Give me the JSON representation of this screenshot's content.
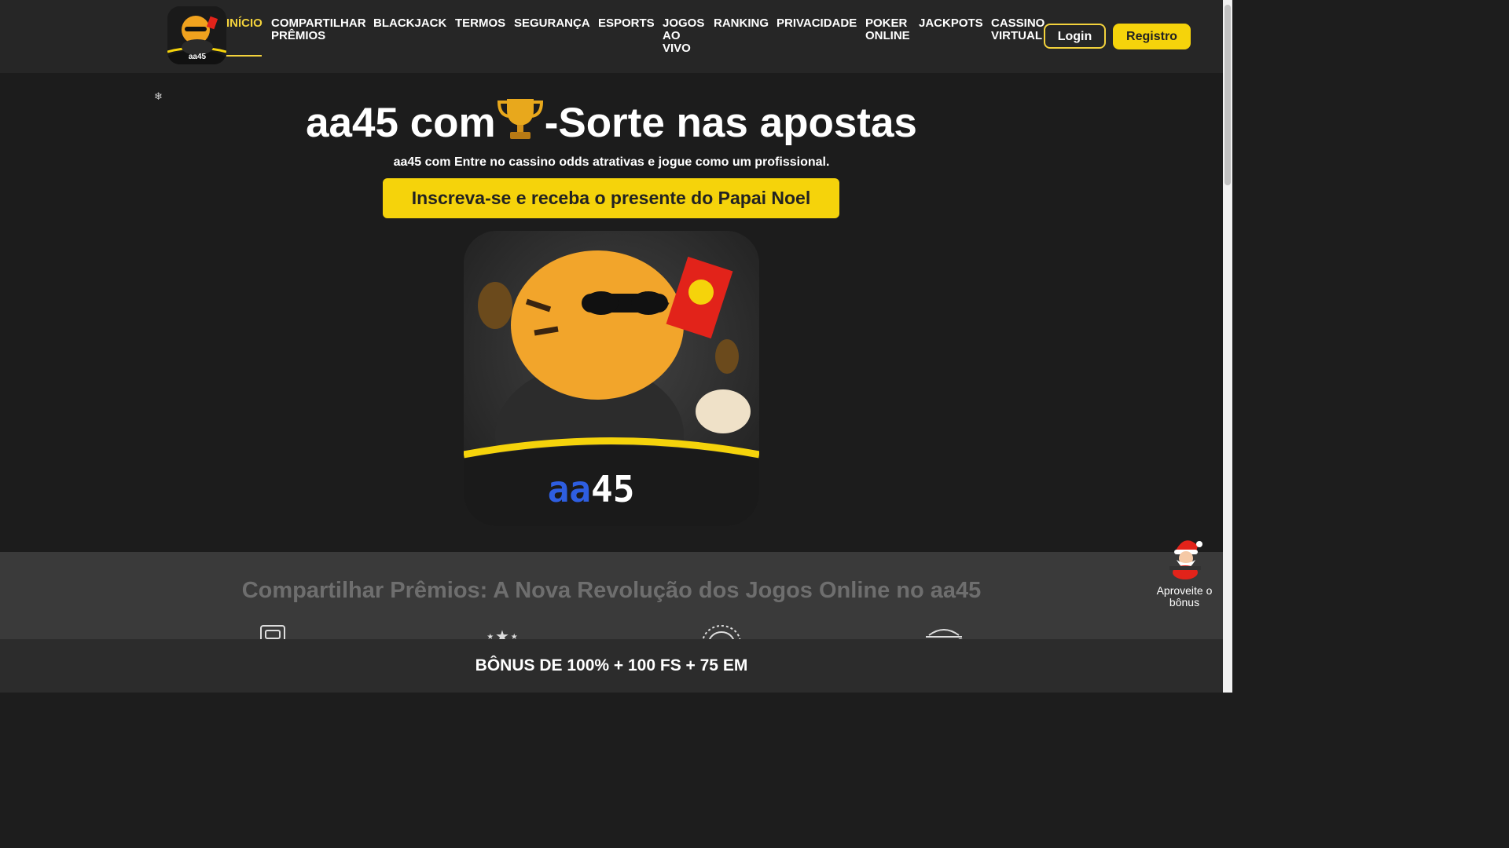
{
  "header": {
    "nav": [
      {
        "label": "INÍCIO",
        "active": true
      },
      {
        "label": "COMPARTILHAR PRÊMIOS"
      },
      {
        "label": "BLACKJACK"
      },
      {
        "label": "TERMOS"
      },
      {
        "label": "SEGURANÇA"
      },
      {
        "label": "ESPORTS"
      },
      {
        "label": "JOGOS AO VIVO"
      },
      {
        "label": "RANKING"
      },
      {
        "label": "PRIVACIDADE"
      },
      {
        "label": "POKER ONLINE"
      },
      {
        "label": "JACKPOTS"
      },
      {
        "label": "CASSINO VIRTUAL"
      }
    ],
    "login_label": "Login",
    "register_label": "Registro",
    "logo_text": "aa45"
  },
  "hero": {
    "title_before": "aa45 com",
    "title_after": "-Sorte nas apostas",
    "subtitle": "aa45 com Entre no cassino odds atrativas e jogue como um profissional.",
    "cta_label": "Inscreva-se e receba o presente do Papai Noel",
    "image_text_blue": "aa",
    "image_text_white": "45"
  },
  "section2": {
    "title": "Compartilhar Prêmios: A Nova Revolução dos Jogos Online no aa45",
    "feature_icons": [
      "slot-machine-icon",
      "stars-icon",
      "roulette-icon",
      "basket-icon"
    ]
  },
  "bonus_float": {
    "label": "Aproveite o bônus"
  },
  "bottom_bar": {
    "text": "BÔNUS DE 100% + 100 FS + 75 EM"
  },
  "colors": {
    "accent": "#f5d30b",
    "background": "#1c1c1c",
    "header": "#262626"
  }
}
